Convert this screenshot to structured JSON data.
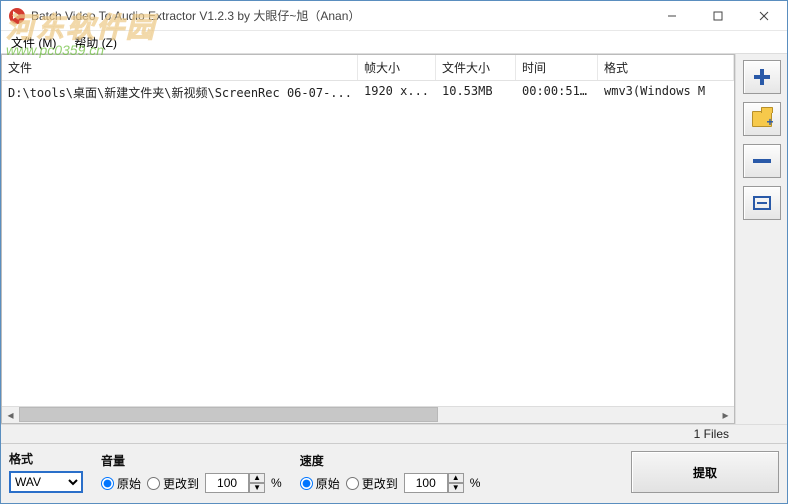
{
  "window": {
    "title": "Batch Video To Audio Extractor V1.2.3 by 大眼仔~旭（Anan）"
  },
  "menu": {
    "file": "文件 (M)",
    "help": "帮助 (Z)"
  },
  "columns": {
    "file": "文件",
    "frame": "帧大小",
    "size": "文件大小",
    "time": "时间",
    "format": "格式"
  },
  "rows": [
    {
      "file": "D:\\tools\\桌面\\新建文件夹\\新视频\\ScreenRec 06-07-...",
      "frame": "1920 x...",
      "size": "10.53MB",
      "time": "00:00:51...",
      "format": "wmv3(Windows M"
    }
  ],
  "status": {
    "files": "1 Files"
  },
  "bottom": {
    "format_label": "格式",
    "format_value": "WAV",
    "volume_label": "音量",
    "speed_label": "速度",
    "radio_original": "原始",
    "radio_changeto": "更改到",
    "percent": "%",
    "spin_value": "100",
    "extract": "提取"
  },
  "watermark": {
    "line1": "河东软件园",
    "line2": "www.pc0359.cn"
  }
}
